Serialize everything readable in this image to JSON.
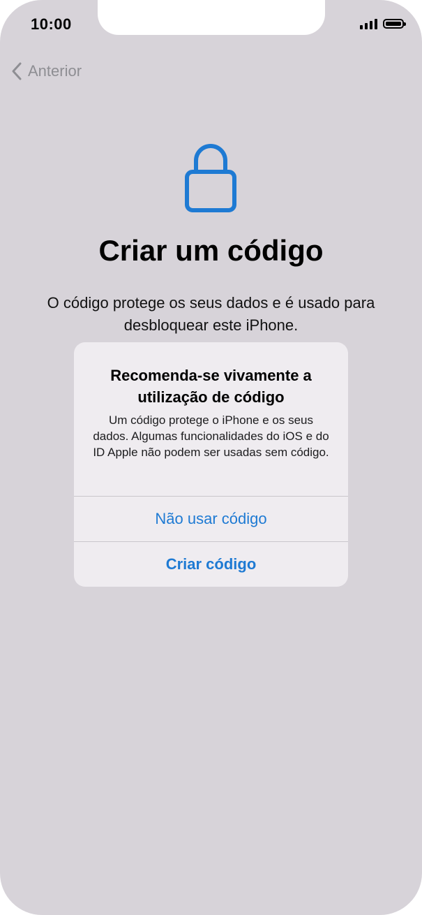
{
  "status_bar": {
    "time": "10:00"
  },
  "nav": {
    "back_label": "Anterior"
  },
  "main": {
    "icon": "lock-icon",
    "title": "Criar um código",
    "description": "O código protege os seus dados e é usado para desbloquear este iPhone."
  },
  "alert": {
    "title": "Recomenda-se vivamente a utilização de código",
    "message": "Um código protege o iPhone e os seus dados. Algumas funcionalidades do iOS e do ID Apple não podem ser usadas sem código.",
    "buttons": [
      {
        "label": "Não usar código"
      },
      {
        "label": "Criar código"
      }
    ]
  },
  "colors": {
    "accent": "#1e7ad3",
    "background": "#d7d3d9",
    "alert_background": "#efecf0",
    "back_gray": "#8e8e93"
  }
}
